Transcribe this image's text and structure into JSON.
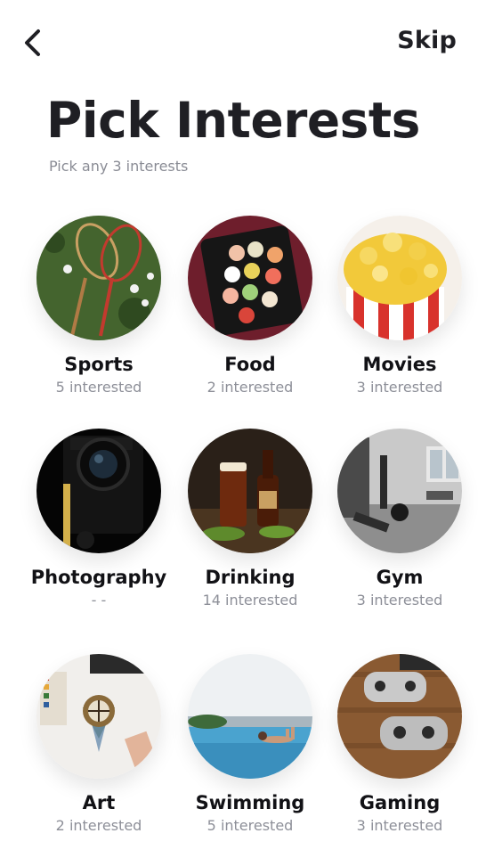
{
  "header": {
    "back_icon": "chevron-left-icon",
    "skip_label": "Skip"
  },
  "title": "Pick Interests",
  "subtitle": "Pick any 3 interests",
  "interests": [
    {
      "label": "Sports",
      "count": "5 interested",
      "image": "badminton rackets and shuttlecocks on grass"
    },
    {
      "label": "Food",
      "count": "2 interested",
      "image": "sushi platter"
    },
    {
      "label": "Movies",
      "count": "3 interested",
      "image": "popcorn box"
    },
    {
      "label": "Photography",
      "count": "- -",
      "image": "camera on dark background"
    },
    {
      "label": "Drinking",
      "count": "14 interested",
      "image": "beer glass and bottle"
    },
    {
      "label": "Gym",
      "count": "3 interested",
      "image": "gym interior"
    },
    {
      "label": "Art",
      "count": "2 interested",
      "image": "compass painting on paper"
    },
    {
      "label": "Swimming",
      "count": "5 interested",
      "image": "person in infinity pool"
    },
    {
      "label": "Gaming",
      "count": "3 interested",
      "image": "two game controllers on wood"
    }
  ]
}
